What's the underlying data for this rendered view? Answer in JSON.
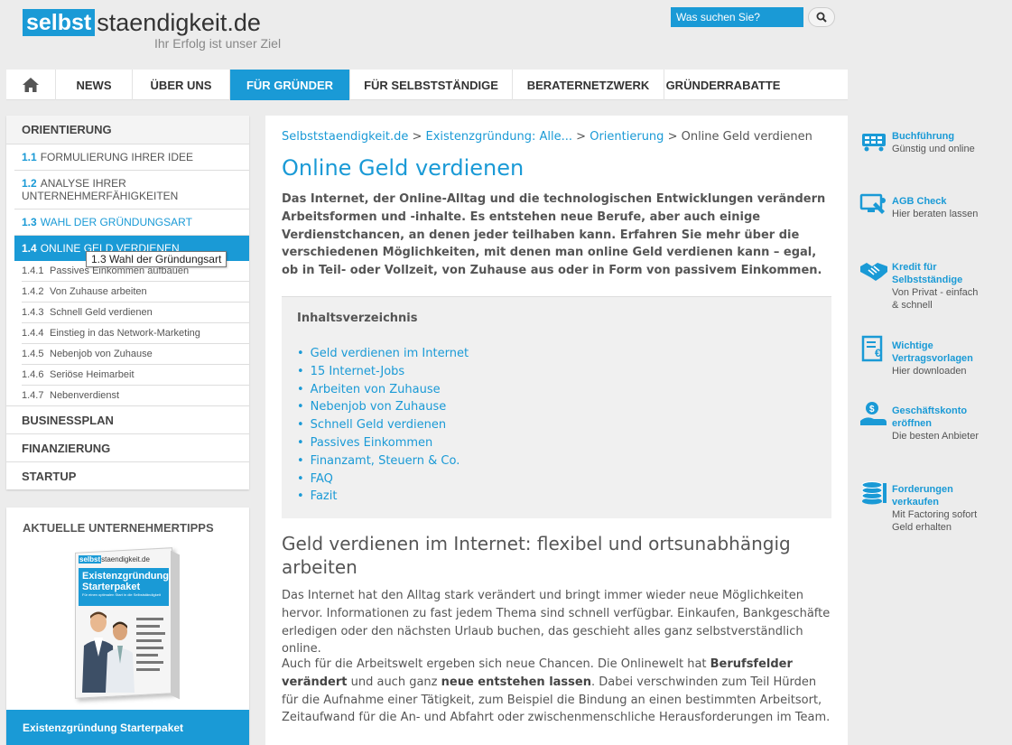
{
  "header": {
    "logo_box": "selbst",
    "logo_rest": "staendigkeit.de",
    "logo_tag": "Ihr Erfolg ist unser Ziel",
    "search_placeholder": "Was suchen Sie?"
  },
  "nav": {
    "items": [
      "NEWS",
      "ÜBER UNS",
      "FÜR GRÜNDER",
      "FÜR SELBSTSTÄNDIGE",
      "BERATERNETZWERK",
      "GRÜNDERRABATTE"
    ],
    "active": "FÜR GRÜNDER"
  },
  "sidebar": {
    "heading": "ORIENTIERUNG",
    "items": [
      {
        "num": "1.1",
        "label": "FORMULIERUNG IHRER IDEE"
      },
      {
        "num": "1.2",
        "label": "ANALYSE IHRER UNTERNEHMERFÄHIGKEITEN"
      },
      {
        "num": "1.3",
        "label": "WAHL DER GRÜNDUNGSART"
      },
      {
        "num": "1.4",
        "label": "ONLINE GELD VERDIENEN"
      }
    ],
    "subitems": [
      {
        "num": "1.4.1",
        "label": "Passives Einkommen aufbauen"
      },
      {
        "num": "1.4.2",
        "label": "Von Zuhause arbeiten"
      },
      {
        "num": "1.4.3",
        "label": "Schnell Geld verdienen"
      },
      {
        "num": "1.4.4",
        "label": "Einstieg in das Network-Marketing"
      },
      {
        "num": "1.4.5",
        "label": "Nebenjob von Zuhause"
      },
      {
        "num": "1.4.6",
        "label": "Seriöse Heimarbeit"
      },
      {
        "num": "1.4.7",
        "label": "Nebenverdienst"
      }
    ],
    "sections": [
      "BUSINESSPLAN",
      "FINANZIERUNG",
      "STARTUP"
    ],
    "tooltip": "1.3 Wahl der Gründungsart"
  },
  "tips": {
    "heading": "AKTUELLE UNTERNEHMERTIPPS",
    "product_logo_box": "selbst",
    "product_logo_rest": "staendigkeit.de",
    "product_title_1": "Existenzgründung",
    "product_title_2": "Starterpaket",
    "product_sub": "Für einen optimalen Start in die Selbstständigkeit",
    "footer": "Existenzgründung Starterpaket"
  },
  "main": {
    "breadcrumb": {
      "home": "Selbststaendigkeit.de",
      "sep": " > ",
      "cat": "Existenzgründung: Alle...",
      "sub": "Orientierung",
      "current": "Online Geld verdienen"
    },
    "title": "Online Geld verdienen",
    "intro": "Das Internet, der Online-Alltag und die technologischen Entwicklungen verändern Arbeitsformen und -inhalte. Es entstehen neue Berufe, aber auch einige Verdienstchancen, an denen jeder teilhaben kann. Erfahren Sie mehr über die verschiedenen Möglichkeiten, mit denen man online Geld verdienen kann – egal, ob in Teil- oder Vollzeit, von Zuhause aus oder in Form von passivem Einkommen.",
    "toc": {
      "title": "Inhaltsverzeichnis",
      "items": [
        "Geld verdienen im Internet",
        "15 Internet-Jobs",
        "Arbeiten von Zuhause",
        "Nebenjob von Zuhause",
        "Schnell Geld verdienen",
        "Passives Einkommen",
        "Finanzamt, Steuern & Co.",
        "FAQ",
        "Fazit"
      ]
    },
    "h2": "Geld verdienen im Internet: flexibel und ortsunabhängig arbeiten",
    "para1": "Das Internet hat den Alltag stark verändert und bringt immer wieder neue Möglichkeiten hervor. Informationen zu fast jedem Thema sind schnell verfügbar. Einkaufen, Bankgeschäfte erledigen oder den nächsten Urlaub buchen, das geschieht alles ganz selbstverständlich online.",
    "para2": {
      "t1": "Auch für die Arbeitswelt ergeben sich neue Chancen. Die Onlinewelt hat ",
      "b1": "Berufsfelder verändert",
      "t2": " und auch ganz ",
      "b2": "neue entstehen lassen",
      "t3": ". Dabei verschwinden zum Teil Hürden für die Aufnahme einer Tätigkeit, zum Beispiel die Bindung an einen bestimmten Arbeitsort, Zeitaufwand für die An- und Abfahrt oder zwischenmenschliche Herausforderungen im Team."
    }
  },
  "right": {
    "items": [
      {
        "title": "Buchführung",
        "sub": "Günstig und online",
        "icon": "bookkeeping-icon"
      },
      {
        "title": "AGB Check",
        "sub": "Hier beraten lassen",
        "icon": "agb-check-icon"
      },
      {
        "title": "Kredit für Selbstständige",
        "sub": "Von Privat - einfach & schnell",
        "icon": "handshake-icon"
      },
      {
        "title": "Wichtige Vertragsvorlagen",
        "sub": "Hier downloaden",
        "icon": "contract-icon"
      },
      {
        "title": "Geschäftskonto eröffnen",
        "sub": "Die besten Anbieter",
        "icon": "account-icon"
      },
      {
        "title": "Forderungen verkaufen",
        "sub": "Mit Factoring sofort Geld erhalten",
        "icon": "factoring-icon"
      }
    ]
  },
  "colors": {
    "accent": "#1a9ad6",
    "background": "#ececec"
  }
}
